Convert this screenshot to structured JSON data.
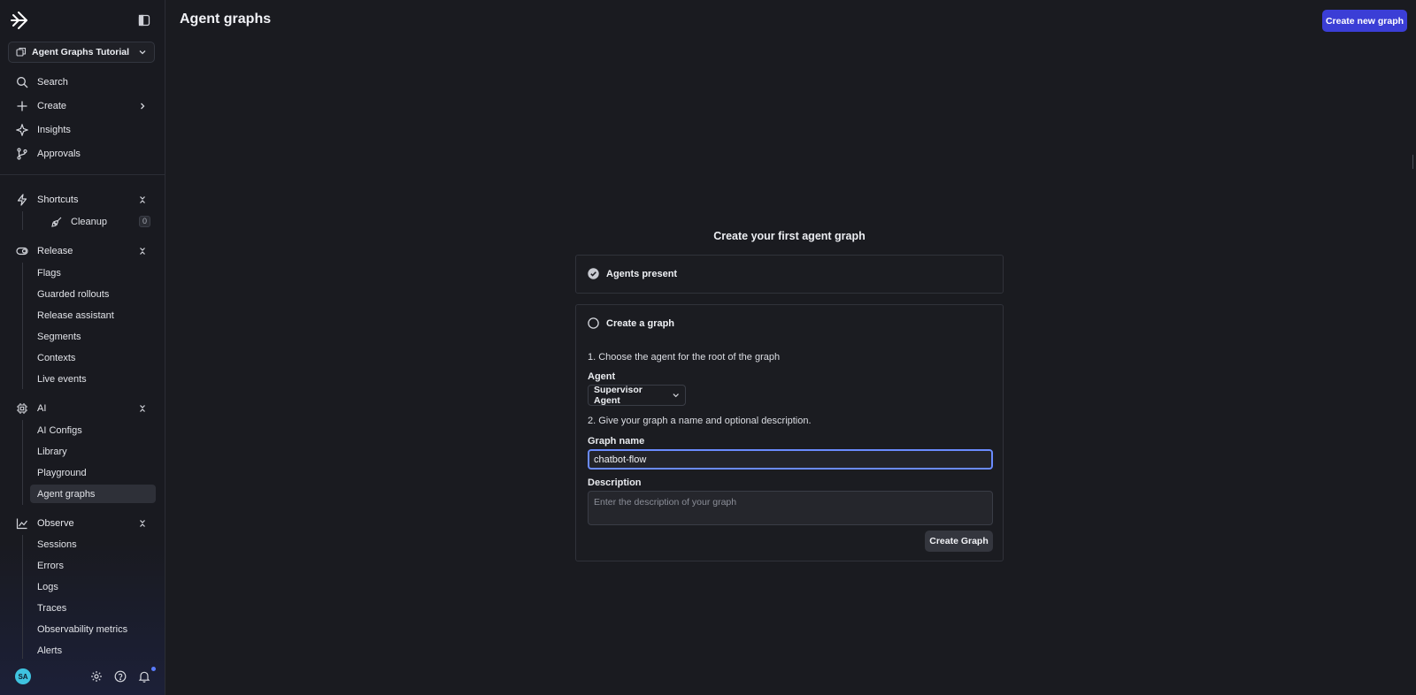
{
  "sidebar": {
    "project": "Agent Graphs Tutorial",
    "nav": [
      {
        "label": "Search",
        "icon": "search-icon"
      },
      {
        "label": "Create",
        "icon": "plus-icon",
        "trailing": "chevron-right-icon"
      },
      {
        "label": "Insights",
        "icon": "sparkle-icon"
      },
      {
        "label": "Approvals",
        "icon": "git-branch-icon"
      }
    ],
    "shortcuts": {
      "label": "Shortcuts",
      "icon": "lightning-icon",
      "items": [
        {
          "label": "Cleanup",
          "icon": "broom-icon",
          "badge": "0"
        }
      ]
    },
    "release": {
      "label": "Release",
      "icon": "toggle-icon",
      "items": [
        "Flags",
        "Guarded rollouts",
        "Release assistant",
        "Segments",
        "Contexts",
        "Live events"
      ]
    },
    "ai": {
      "label": "AI",
      "icon": "chip-icon",
      "items": [
        "AI Configs",
        "Library",
        "Playground",
        "Agent graphs"
      ],
      "active": "Agent graphs"
    },
    "observe": {
      "label": "Observe",
      "icon": "chart-icon",
      "items": [
        "Sessions",
        "Errors",
        "Logs",
        "Traces",
        "Observability metrics",
        "Alerts"
      ]
    },
    "user_initials": "SA"
  },
  "header": {
    "title": "Agent graphs",
    "create_new_label": "Create new graph"
  },
  "main": {
    "title": "Create your first agent graph",
    "step1": {
      "label": "Agents present",
      "status": "complete"
    },
    "step2": {
      "label": "Create a graph",
      "instruction1": "1. Choose the agent for the root of the graph",
      "agent_label": "Agent",
      "agent_value": "Supervisor Agent",
      "instruction2": "2. Give your graph a name and optional description.",
      "name_label": "Graph name",
      "name_value": "chatbot-flow",
      "description_label": "Description",
      "description_placeholder": "Enter the description of your graph",
      "submit_label": "Create Graph"
    }
  },
  "colors": {
    "accent": "#3b3ed6",
    "focus": "#6a8bff",
    "background": "#1a1b20"
  }
}
